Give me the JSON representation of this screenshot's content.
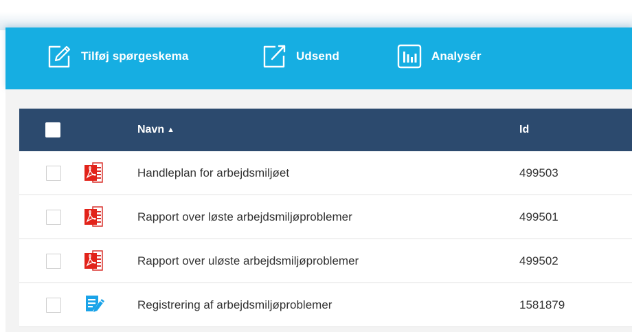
{
  "toolbar": {
    "add_questionnaire_label": "Tilføj spørgeskema",
    "send_label": "Udsend",
    "analyze_label": "Analysér",
    "background_color": "#16aee2"
  },
  "table": {
    "header": {
      "name_label": "Navn",
      "name_sort_indicator": "▲",
      "id_label": "Id",
      "background_color": "#2c4a6e"
    },
    "rows": [
      {
        "icon": "pdf-icon",
        "name": "Handleplan for arbejdsmiljøet",
        "id": "499503"
      },
      {
        "icon": "pdf-icon",
        "name": "Rapport over løste arbejdsmiljøproblemer",
        "id": "499501"
      },
      {
        "icon": "pdf-icon",
        "name": "Rapport over uløste arbejdsmiljøproblemer",
        "id": "499502"
      },
      {
        "icon": "form-edit-icon",
        "name": "Registrering af arbejdsmiljøproblemer",
        "id": "1581879"
      }
    ]
  }
}
